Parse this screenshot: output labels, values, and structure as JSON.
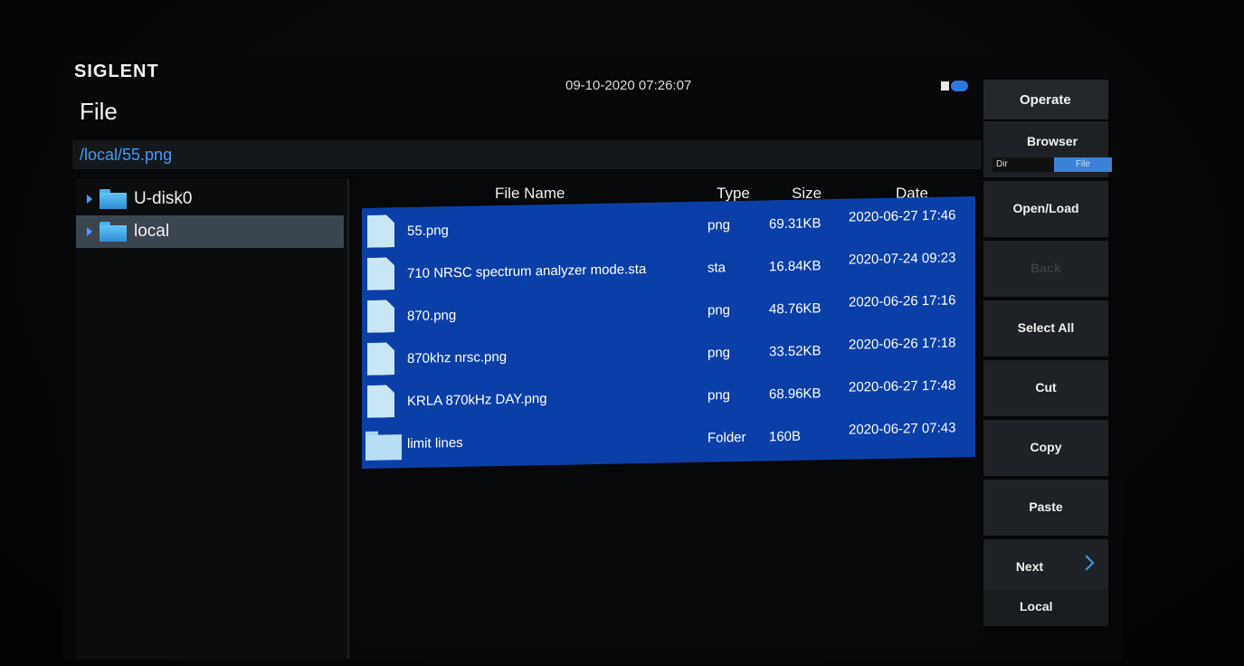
{
  "header": {
    "brand": "SIGLENT",
    "title": "File",
    "datetime": "09-10-2020 07:26:07",
    "path": "/local/55.png"
  },
  "tree": {
    "items": [
      {
        "label": "U-disk0"
      },
      {
        "label": "local"
      }
    ]
  },
  "list": {
    "columns": {
      "name": "File Name",
      "type": "Type",
      "size": "Size",
      "date": "Date"
    },
    "rows": [
      {
        "name": "55.png",
        "type": "png",
        "size": "69.31KB",
        "date": "2020-06-27 17:46"
      },
      {
        "name": "710 NRSC spectrum analyzer mode.sta",
        "type": "sta",
        "size": "16.84KB",
        "date": "2020-07-24 09:23"
      },
      {
        "name": "870.png",
        "type": "png",
        "size": "48.76KB",
        "date": "2020-06-26 17:16"
      },
      {
        "name": "870khz nrsc.png",
        "type": "png",
        "size": "33.52KB",
        "date": "2020-06-26 17:18"
      },
      {
        "name": "KRLA 870kHz DAY.png",
        "type": "png",
        "size": "68.96KB",
        "date": "2020-06-27 17:48"
      },
      {
        "name": "limit lines",
        "type": "Folder",
        "size": "160B",
        "date": "2020-06-27 07:43"
      }
    ]
  },
  "menu": {
    "title": "Operate",
    "browser_label": "Browser",
    "browser_options": [
      "Dir",
      "File"
    ],
    "keys": [
      {
        "label": "Open/Load"
      },
      {
        "label": "Back"
      },
      {
        "label": "Select All"
      },
      {
        "label": "Cut"
      },
      {
        "label": "Copy"
      },
      {
        "label": "Paste"
      },
      {
        "label": "Next"
      }
    ],
    "local_label": "Local"
  },
  "colors": {
    "accent": "#3d9bff",
    "selection": "#0b3fa8",
    "toggle_active": "#3b82d8"
  }
}
